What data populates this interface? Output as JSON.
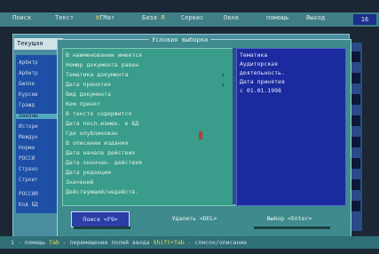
{
  "menu": {
    "items": [
      {
        "label": "Поиск",
        "hotkey": ""
      },
      {
        "label": "Текст",
        "hotkey": ""
      },
      {
        "label": "ГМат",
        "hotkey": "б"
      },
      {
        "label": "База",
        "hotkey": "Я"
      },
      {
        "label": "Сервис",
        "hotkey": ""
      },
      {
        "label": "Окна",
        "hotkey": ""
      },
      {
        "label": "помощь",
        "hotkey": ""
      },
      {
        "label": "Выход",
        "hotkey": ""
      }
    ],
    "clock": "16"
  },
  "background_window": {
    "tab": "Текущая",
    "list": [
      "Арбитр",
      "Арбитр",
      "Бюлле",
      "Курсив",
      "Гражд",
      "Законы",
      "Истори",
      "Междун",
      "Норма",
      "РОССИ",
      "Страхо",
      "Строит",
      "РОССИЯ",
      "Код БД"
    ],
    "selected_index": 5
  },
  "dialog": {
    "title": "Условия выборки",
    "criteria": [
      "В наименовании имеется",
      "Номер документа равен",
      "Тематика документа",
      "Дата принятия",
      "Вид документа",
      "Кем принят",
      "В тексте содержится",
      "Дата посл.измен. в БД",
      "Где опубликован",
      "В описании издания",
      "Дата начала действия",
      "Дата окончан. действия",
      "Дата редакции",
      "Значений",
      "Действующий/недейств."
    ],
    "marks": [
      "↓",
      "↓"
    ],
    "summary": [
      "Тематика",
      "Аудиторская",
      "деятельность.",
      "Дата принятия",
      " с 01.01.1998"
    ],
    "buttons": {
      "search": "Поиск <F9>",
      "delete": "Удалить <DEL>",
      "choose": "Выбор <Enter>"
    }
  },
  "statusbar": {
    "prefix": "1 - помощь ",
    "key1": "Tab",
    "middle": " - перемещение полей ввода ",
    "key2": "Shift+Tab",
    "suffix": " - список/описание"
  }
}
